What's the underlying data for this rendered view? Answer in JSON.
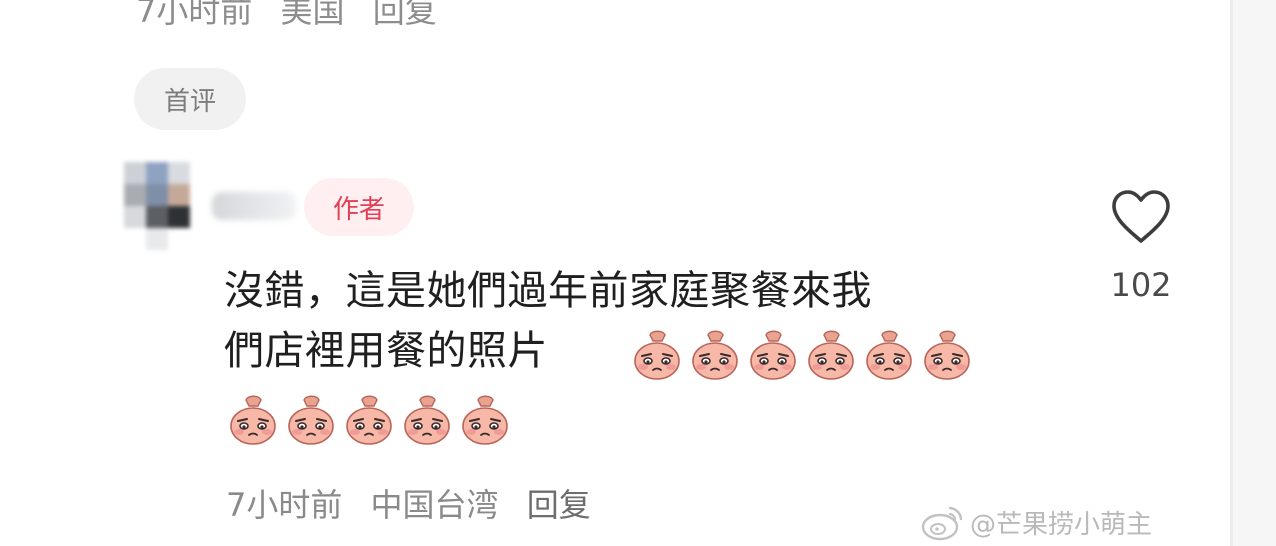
{
  "previous_comment": {
    "time": "7小时前",
    "location": "美国",
    "reply_label": "回复"
  },
  "tag_chip": "首评",
  "comment": {
    "avatar_icon": "blurred-avatar",
    "author_badge": "作者",
    "text_line1": "沒錯，這是她們過年前家庭聚餐來我",
    "text_line2": "們店裡用餐的照片",
    "emoji_icon": "pleading-face-emoji",
    "emoji_count_line1": 6,
    "emoji_count_line2": 5,
    "like_icon": "heart-outline-icon",
    "like_count": "102",
    "time": "7小时前",
    "location": "中国台湾",
    "reply_label": "回复"
  },
  "watermark": {
    "icon": "weibo-icon",
    "text": "@芒果捞小萌主"
  },
  "colors": {
    "badge_text": "#e33f56",
    "badge_bg": "#ffeff0",
    "chip_bg": "#f1f1f2",
    "meta_text": "#8a8a8a"
  }
}
